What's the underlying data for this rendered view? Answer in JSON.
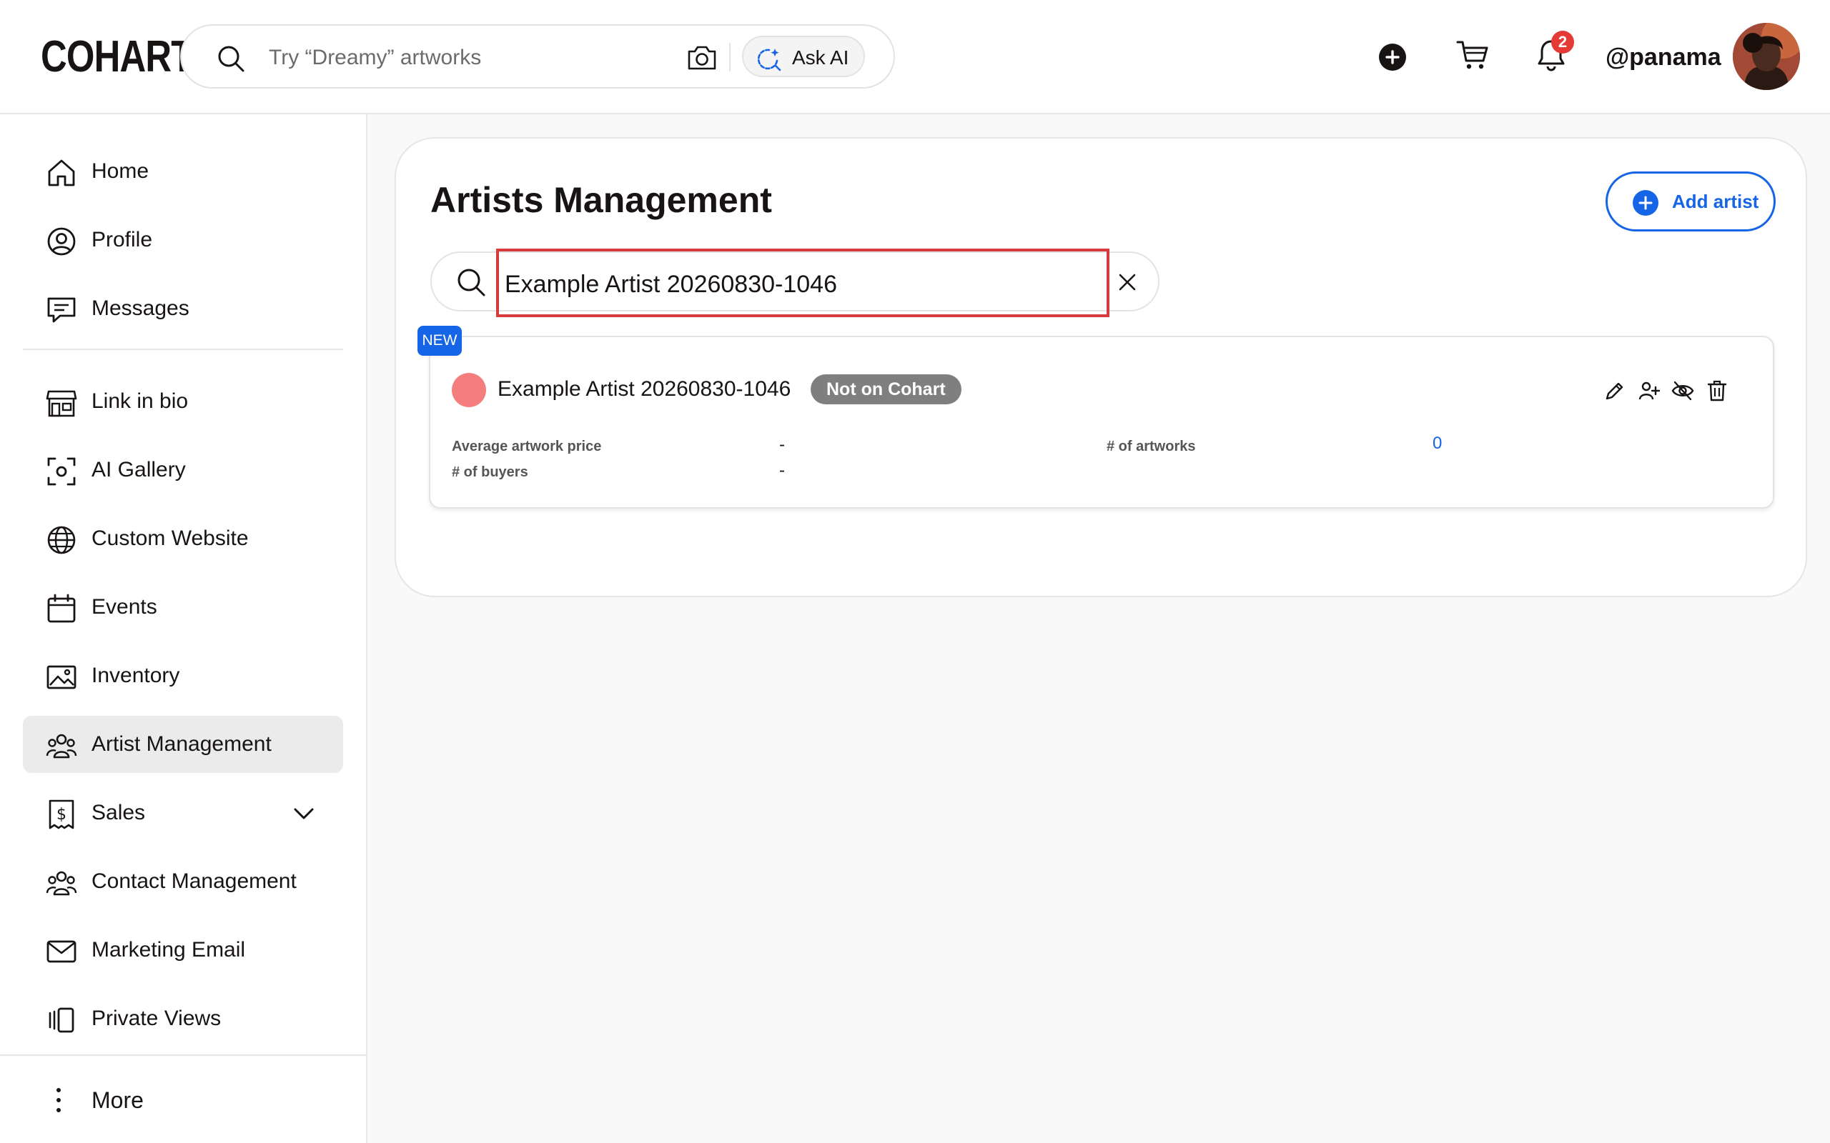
{
  "header": {
    "logo": "COHART",
    "search_placeholder": "Try “Dreamy” artworks",
    "ask_ai_label": "Ask AI",
    "notification_count": "2",
    "username": "@panama"
  },
  "sidebar": {
    "items_top": [
      {
        "label": "Home",
        "icon": "home-icon"
      },
      {
        "label": "Profile",
        "icon": "profile-icon"
      },
      {
        "label": "Messages",
        "icon": "messages-icon"
      }
    ],
    "items_main": [
      {
        "label": "Link in bio",
        "icon": "storefront-icon"
      },
      {
        "label": "AI Gallery",
        "icon": "ai-scan-icon"
      },
      {
        "label": "Custom Website",
        "icon": "globe-icon"
      },
      {
        "label": "Events",
        "icon": "calendar-icon"
      },
      {
        "label": "Inventory",
        "icon": "image-icon"
      },
      {
        "label": "Artist Management",
        "icon": "users-icon",
        "active": true
      },
      {
        "label": "Sales",
        "icon": "dollar-icon"
      },
      {
        "label": "Contact Management",
        "icon": "contacts-icon"
      },
      {
        "label": "Marketing Email",
        "icon": "mail-icon"
      },
      {
        "label": "Private Views",
        "icon": "private-views-icon"
      }
    ],
    "more_label": "More"
  },
  "main": {
    "title": "Artists Management",
    "add_artist_label": "Add artist",
    "search_value": "Example Artist 20260830-1046",
    "artist": {
      "badge": "NEW",
      "name": "Example Artist 20260830-1046",
      "status": "Not on Cohart",
      "avg_price_label": "Average artwork price",
      "avg_price_value": "-",
      "buyers_label": "# of buyers",
      "buyers_value": "-",
      "artworks_label": "# of artworks",
      "artworks_value": "0"
    }
  },
  "colors": {
    "accent": "#1565e6",
    "highlight_border": "#d63b3b",
    "artist_dot": "#f47e7e",
    "status_chip": "#7f7f7f",
    "badge_red": "#e53935"
  }
}
